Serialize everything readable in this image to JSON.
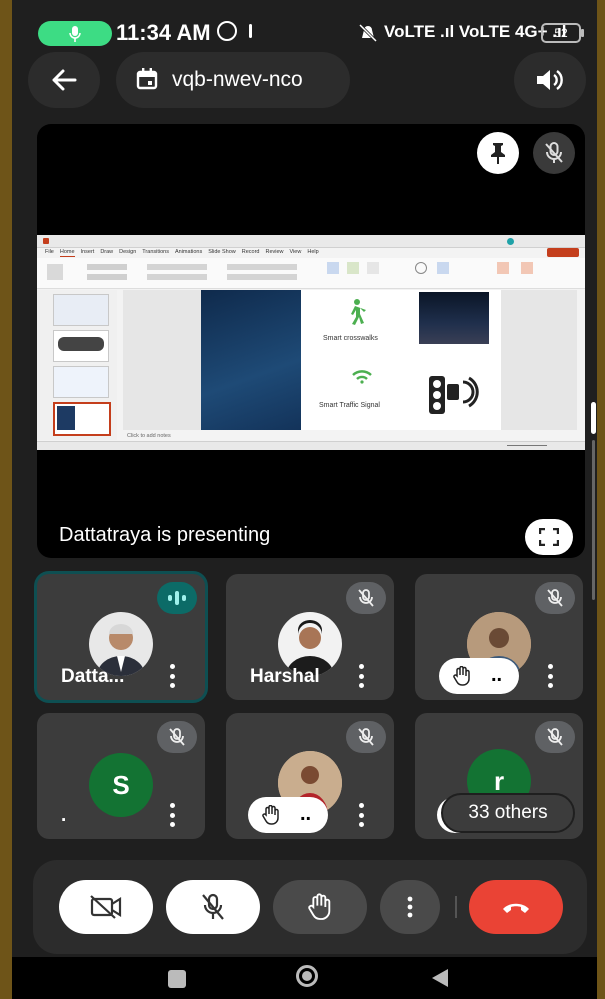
{
  "status_bar": {
    "time": "11:34 AM",
    "network": "VoLTE .ıl VoLTE 4G+ .ıl",
    "battery": "52"
  },
  "header": {
    "meeting_code": "vqb-nwev-nco"
  },
  "presentation": {
    "presenting_text": "Dattatraya is presenting",
    "slide": {
      "item1": "Smart crosswalks",
      "item2": "Smart Traffic Signal",
      "ribbon_tabs": [
        "File",
        "Home",
        "Insert",
        "Draw",
        "Design",
        "Transitions",
        "Animations",
        "Slide Show",
        "Record",
        "Review",
        "View",
        "Help"
      ],
      "notes": "Click to add notes"
    }
  },
  "participants": [
    {
      "name": "Datta...",
      "speaking": true
    },
    {
      "name": "Harshal",
      "muted": true
    },
    {
      "name": "",
      "muted": true,
      "hand_raised_label": ".."
    },
    {
      "name": ".",
      "avatar_letter": "S",
      "muted": true
    },
    {
      "name": "",
      "muted": true,
      "hand_raised_label": ".."
    },
    {
      "name": "",
      "avatar_letter": "r",
      "muted": true,
      "others_label": "33 others"
    }
  ],
  "colors": {
    "background": "#1f1f1f",
    "tile": "#3c3c3c",
    "end_call": "#ea4335",
    "avatar_green": "#137333",
    "mic_pill": "#3ddc84"
  }
}
